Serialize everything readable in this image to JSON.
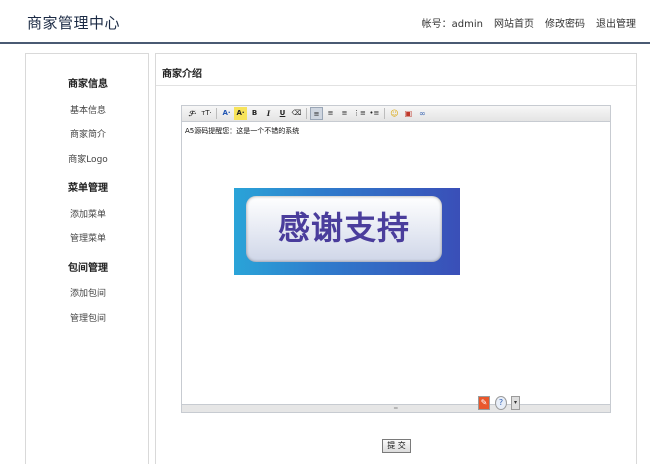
{
  "header": {
    "site_title": "商家管理中心",
    "account_label": "帐号：admin",
    "links": [
      "网站首页",
      "修改密码",
      "退出管理"
    ]
  },
  "sidebar": {
    "groups": [
      {
        "title": "商家信息",
        "items": [
          "基本信息",
          "商家简介",
          "商家Logo"
        ]
      },
      {
        "title": "菜单管理",
        "items": [
          "添加菜单",
          "管理菜单"
        ]
      },
      {
        "title": "包间管理",
        "items": [
          "添加包间",
          "管理包间"
        ]
      }
    ]
  },
  "main": {
    "title": "商家介绍",
    "editor": {
      "toolbar": [
        "ℱ·",
        "тT·",
        "A·",
        "A·",
        "B",
        "I",
        "U",
        "⌫",
        "≡",
        "≡",
        "≡",
        "⋮≡",
        "•≡",
        "☺",
        "▣",
        "∞"
      ],
      "content_text": "A5源码提醒您：这是一个不错的系统",
      "banner_text": "感谢支持",
      "statusbar": {
        "source_icon": "✎",
        "help_icon": "?",
        "more_icon": "▾"
      }
    },
    "submit_label": "提 交"
  },
  "colors": {
    "header_line": "#4a5a73",
    "banner_blue": "#2f7bcc",
    "banner_text": "#4a3d9c"
  }
}
